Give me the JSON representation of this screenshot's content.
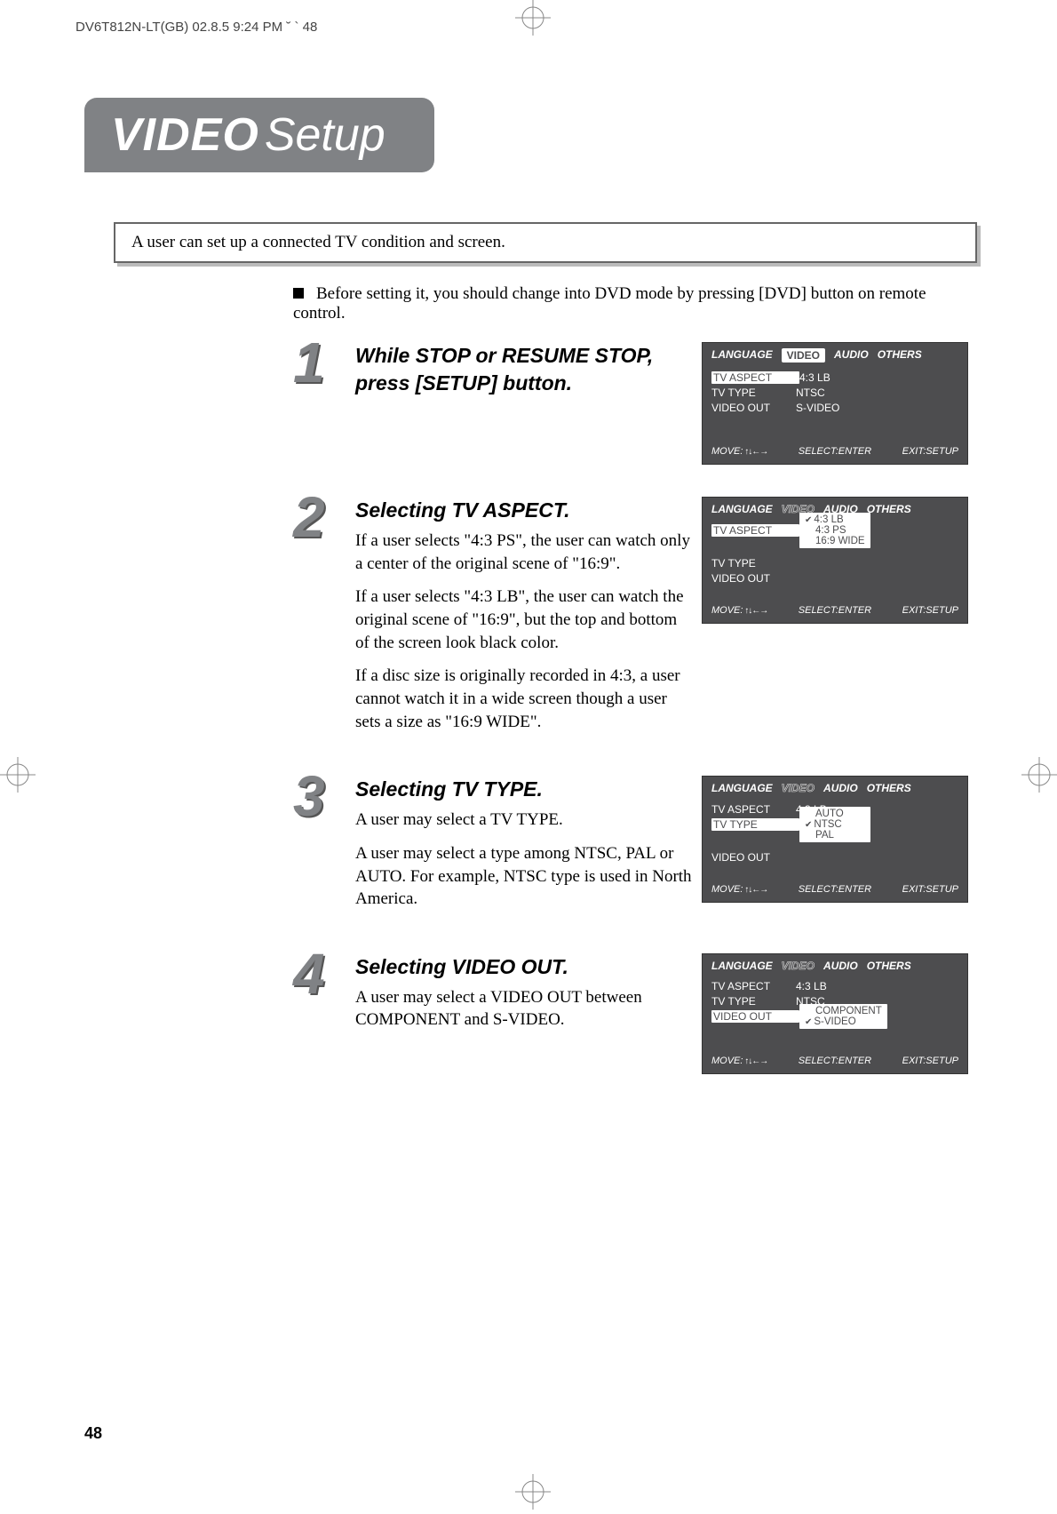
{
  "header_line": "DV6T812N-LT(GB)  02.8.5 9:24 PM  ˘ ` 48",
  "title_main": "VIDEO",
  "title_sub": "Setup",
  "intro": "A user can set up a connected TV condition and screen.",
  "bullet": "Before setting it, you should change into DVD mode by pressing [DVD] button on remote control.",
  "page_number": "48",
  "steps": [
    {
      "num": "1",
      "heading": "While STOP or RESUME STOP, press [SETUP] button.",
      "paragraphs": []
    },
    {
      "num": "2",
      "heading": "Selecting TV ASPECT.",
      "paragraphs": [
        "If a user selects \"4:3 PS\", the user can watch only a center of the original scene of \"16:9\".",
        "If a user selects \"4:3 LB\", the user can watch the original scene of \"16:9\", but the top and bottom of the screen look black color.",
        "If a disc size is originally recorded in 4:3, a user cannot watch it in a wide screen though a user sets a size as \"16:9 WIDE\"."
      ]
    },
    {
      "num": "3",
      "heading": "Selecting TV TYPE.",
      "paragraphs": [
        "A user may select a TV TYPE.",
        "A user may select a type among NTSC, PAL or AUTO. For example, NTSC type is used in North America."
      ]
    },
    {
      "num": "4",
      "heading": "Selecting VIDEO OUT.",
      "paragraphs": [
        "A user may select a VIDEO OUT between COMPONENT and S-VIDEO."
      ]
    }
  ],
  "osd_tabs": {
    "t0": "LANGUAGE",
    "t1": "VIDEO",
    "t2": "AUDIO",
    "t3": "OTHERS"
  },
  "osd_labels": {
    "aspect": "TV ASPECT",
    "type": "TV TYPE",
    "out": "VIDEO OUT"
  },
  "osd_values": {
    "aspect_43lb": "4:3 LB",
    "aspect_43ps": "4:3 PS",
    "aspect_169": "16:9 WIDE",
    "type_ntsc": "NTSC",
    "type_pal": "PAL",
    "type_auto": "AUTO",
    "out_svideo": "S-VIDEO",
    "out_component": "COMPONENT"
  },
  "osd_foot": {
    "move": "MOVE:",
    "select": "SELECT:ENTER",
    "exit": "EXIT:SETUP"
  }
}
